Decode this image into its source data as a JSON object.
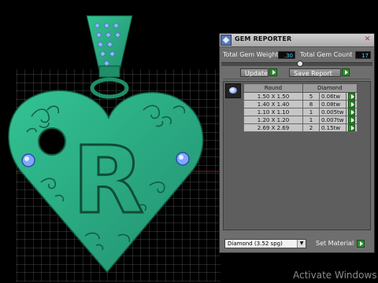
{
  "panel": {
    "title": "GEM REPORTER",
    "close_glyph": "✕",
    "total_weight_label": "Total Gem Weight",
    "total_weight_value": ".30",
    "total_count_label": "Total Gem Count",
    "total_count_value": "17",
    "update_label": "Update",
    "save_label": "Save Report",
    "headers": {
      "round": "Round",
      "diamond": "Diamond"
    },
    "rows": [
      {
        "size": "1.50 X 1.50",
        "count": "5",
        "weight": "0.06tw"
      },
      {
        "size": "1.40 X 1.40",
        "count": "8",
        "weight": "0.08tw"
      },
      {
        "size": "1.10 X 1.10",
        "count": "1",
        "weight": "0.005tw"
      },
      {
        "size": "1.20 X 1.20",
        "count": "1",
        "weight": "0.007tw"
      },
      {
        "size": "2.69 X 2.69",
        "count": "2",
        "weight": "0.15tw"
      }
    ],
    "material_name": "Diamond",
    "material_sg": "(3.52 spg)",
    "set_material_label": "Set Material"
  },
  "model": {
    "letter": "R",
    "colors": {
      "metal": "#2aa97d",
      "metal_dark": "#1b7a57",
      "grid": "#d8d8d8",
      "axis_red": "#c32626",
      "gem_blue": "#7fa7ff"
    }
  },
  "watermark": "Activate Windows"
}
